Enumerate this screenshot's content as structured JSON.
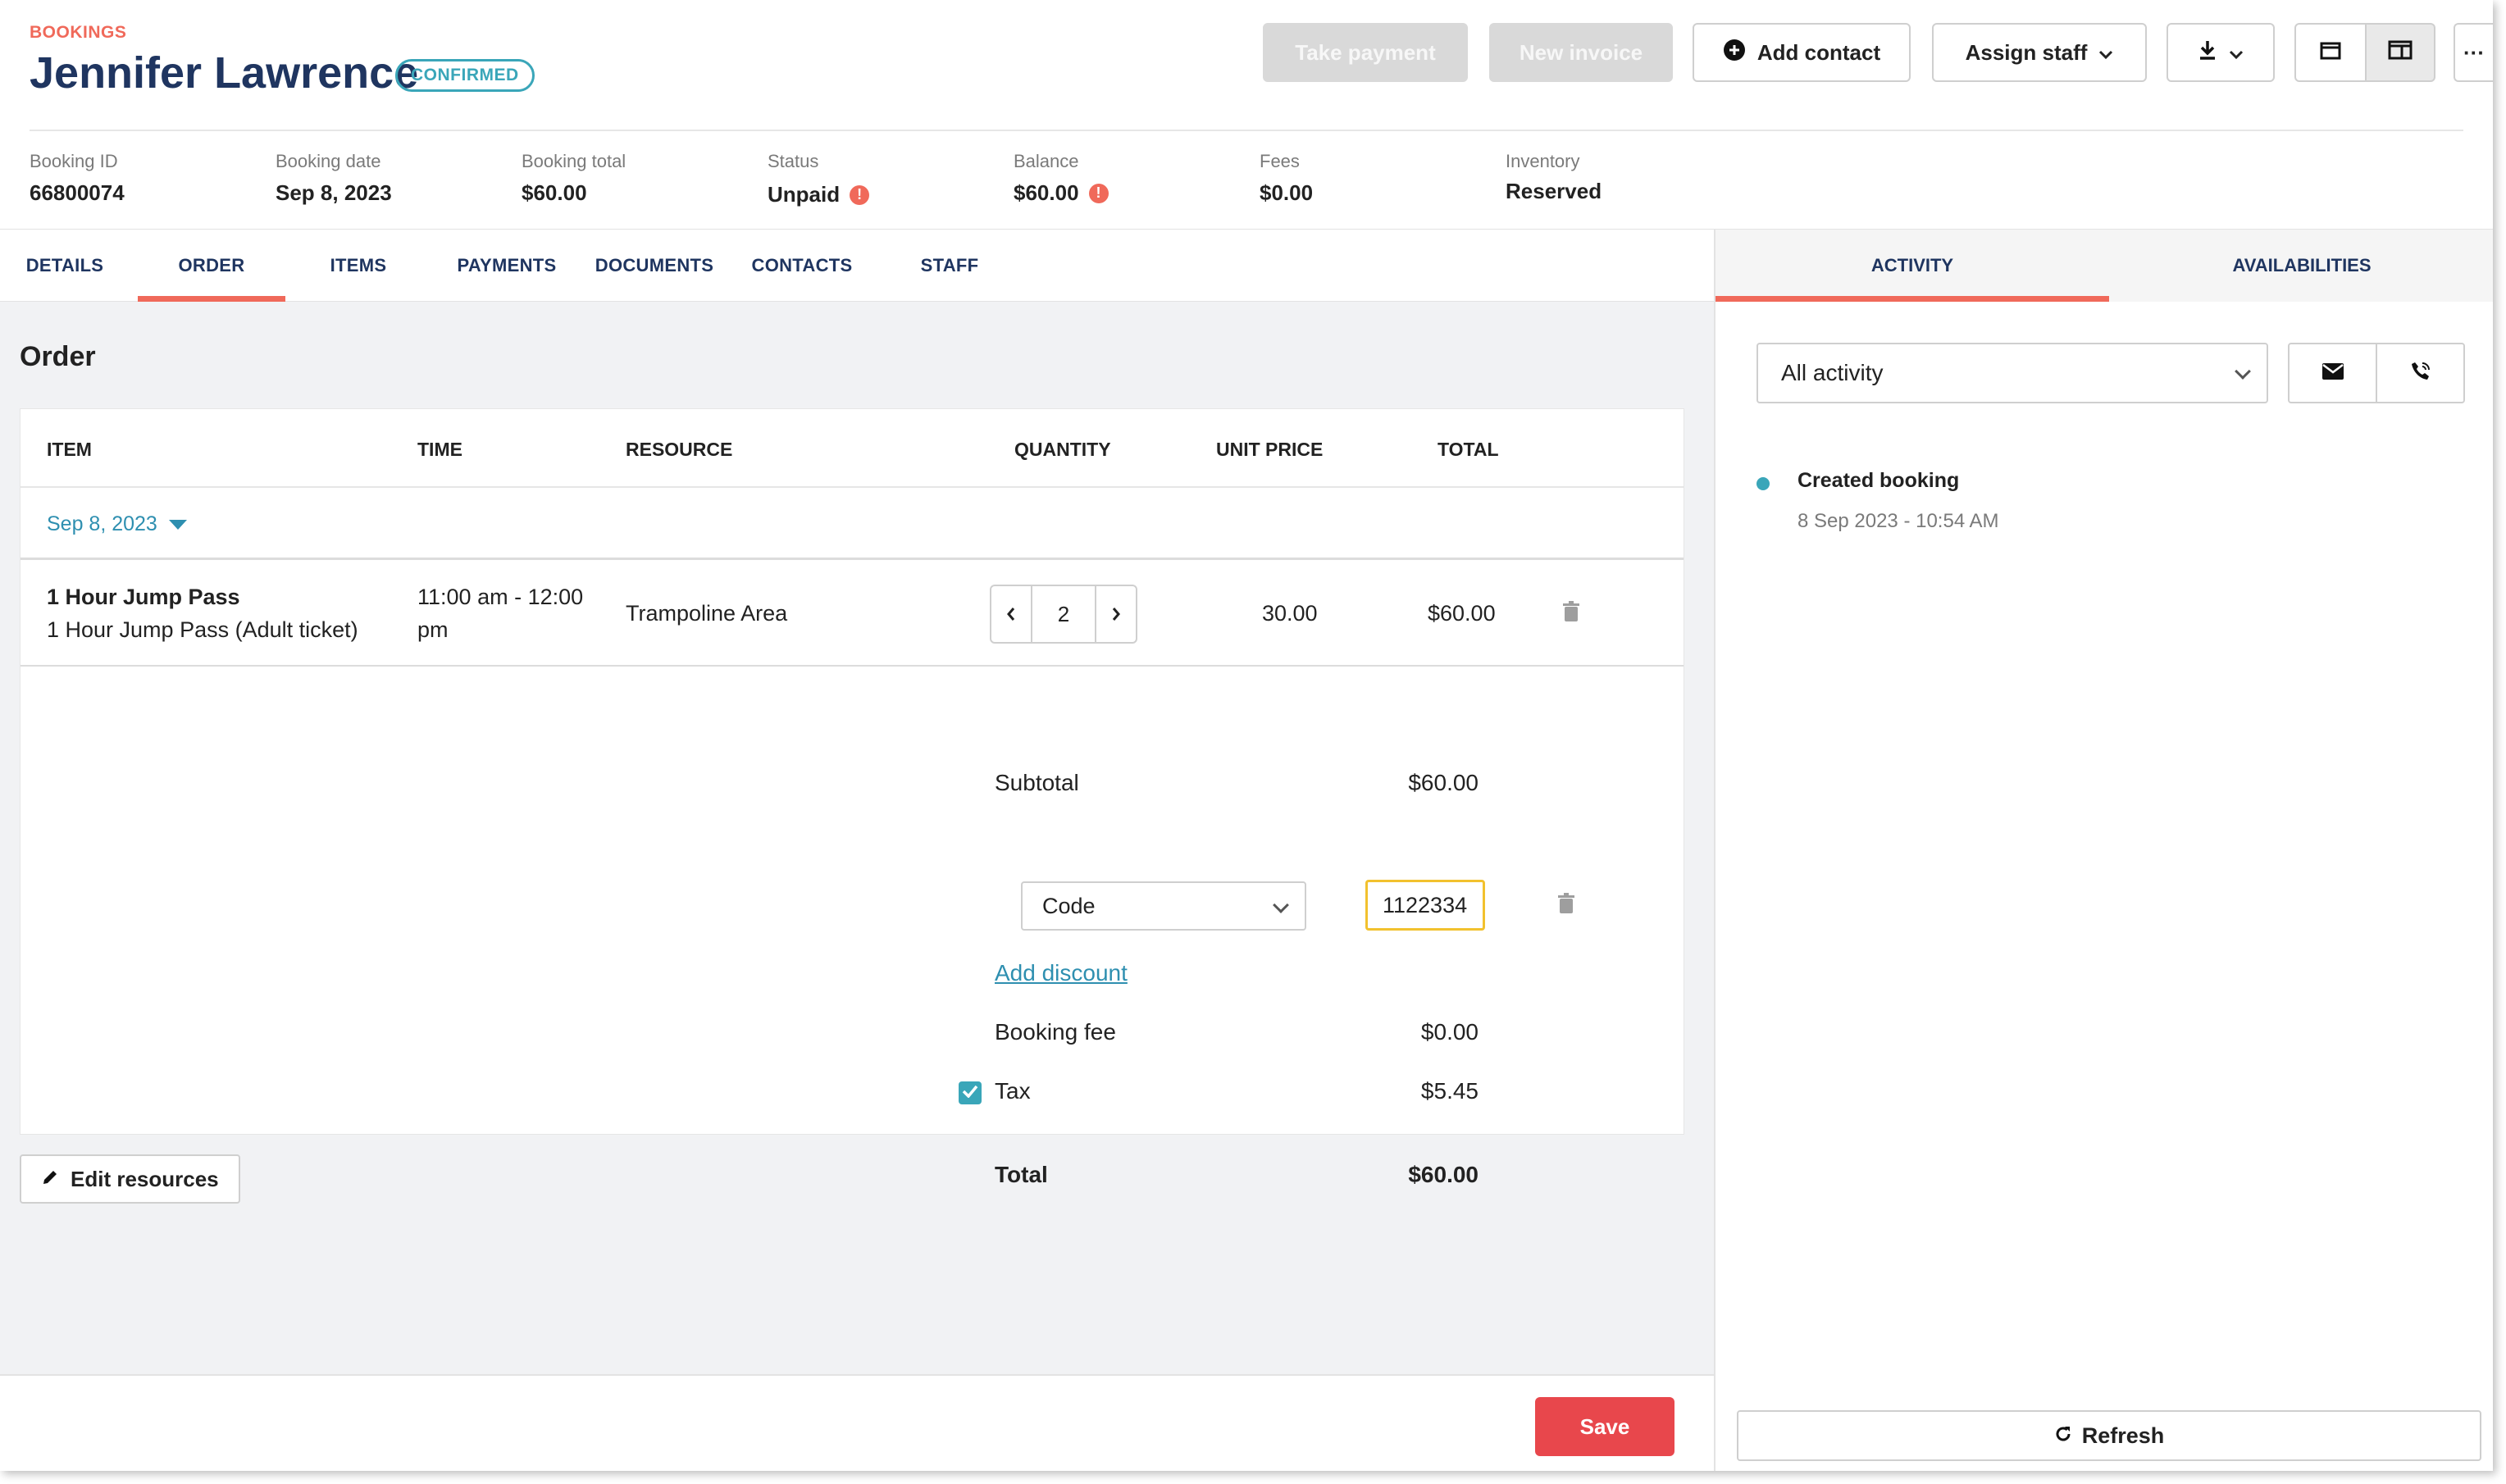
{
  "header": {
    "breadcrumb": "BOOKINGS",
    "title": "Jennifer Lawrence",
    "status_badge": "CONFIRMED",
    "buttons": {
      "take_payment": "Take payment",
      "new_invoice": "New invoice",
      "add_contact": "Add contact",
      "assign_staff": "Assign staff",
      "more": "···"
    }
  },
  "stats": [
    {
      "label": "Booking ID",
      "value": "66800074"
    },
    {
      "label": "Booking date",
      "value": "Sep 8, 2023"
    },
    {
      "label": "Booking total",
      "value": "$60.00"
    },
    {
      "label": "Status",
      "value": "Unpaid"
    },
    {
      "label": "Balance",
      "value": "$60.00"
    },
    {
      "label": "Fees",
      "value": "$0.00"
    },
    {
      "label": "Inventory",
      "value": "Reserved"
    }
  ],
  "tabs": [
    "DETAILS",
    "ORDER",
    "ITEMS",
    "PAYMENTS",
    "DOCUMENTS",
    "CONTACTS",
    "STAFF"
  ],
  "active_tab": "ORDER",
  "order": {
    "section_title": "Order",
    "columns": [
      "ITEM",
      "TIME",
      "RESOURCE",
      "QUANTITY",
      "UNIT PRICE",
      "TOTAL"
    ],
    "date_group": "Sep 8, 2023",
    "item": {
      "name": "1 Hour Jump Pass",
      "variant": "1 Hour Jump Pass (Adult ticket)",
      "time_line1": "11:00 am - 12:00",
      "time_line2": "pm",
      "resource": "Trampoline Area",
      "quantity": "2",
      "unit_price": "30.00",
      "total": "$60.00"
    },
    "summary": {
      "subtotal_label": "Subtotal",
      "subtotal_value": "$60.00",
      "discount_type": "Code",
      "discount_code": "1122334",
      "add_discount": "Add discount",
      "booking_fee_label": "Booking fee",
      "booking_fee_value": "$0.00",
      "tax_label": "Tax",
      "tax_value": "$5.45",
      "tax_checked": true,
      "total_label": "Total",
      "total_value": "$60.00"
    },
    "edit_resources": "Edit resources"
  },
  "footer": {
    "save": "Save"
  },
  "right_panel": {
    "tabs": [
      "ACTIVITY",
      "AVAILABILITIES"
    ],
    "active_tab": "ACTIVITY",
    "filter": "All activity",
    "activity": [
      {
        "title": "Created booking",
        "time": "8 Sep 2023 - 10:54 AM"
      }
    ],
    "refresh": "Refresh"
  },
  "colors": {
    "accent": "#f0695a",
    "teal": "#3aa6b9",
    "navy": "#1f3560",
    "save": "#e8474c",
    "code_focus": "#f2c12e"
  }
}
